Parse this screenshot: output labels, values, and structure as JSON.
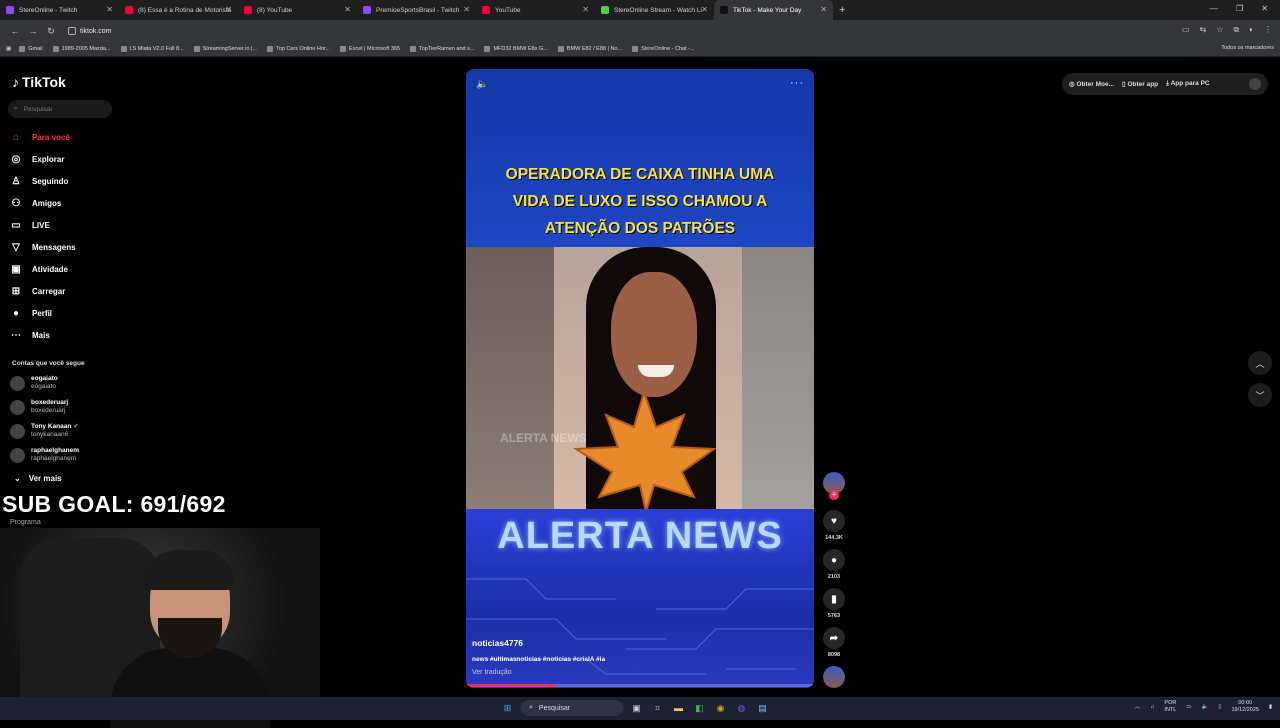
{
  "browser": {
    "tabs": [
      {
        "label": "StereOnline - Twitch",
        "color": "#9146ff"
      },
      {
        "label": "(8) Essa é a Rotina de Motorista",
        "color": "#ff0033"
      },
      {
        "label": "(8) YouTube",
        "color": "#ff0033"
      },
      {
        "label": "PremioeSportsBrasil - Twitch",
        "color": "#9146ff"
      },
      {
        "label": "YouTube",
        "color": "#ff0033"
      },
      {
        "label": "StereOnline Stream - Watch Li",
        "color": "#4bd23a"
      },
      {
        "label": "TikTok - Make Your Day",
        "color": "#111111",
        "active": true
      }
    ],
    "url": "tiktok.com",
    "bookmarks": [
      "Gmail",
      "1989-2005 Mazda...",
      "LS Miata V2.0 Full 8...",
      "StreamingServer.io |...",
      "Top Cars Online Hor...",
      "Excel | Microsoft 365",
      "TopTierRamen and s...",
      "MFD32 BMW E8x G...",
      "BMW E82 / E88 | No...",
      "StereOnline - Chat -..."
    ],
    "bookmarks_right": "Todos os marcadores"
  },
  "sidebar": {
    "logo": "TikTok",
    "search_placeholder": "Pesquisar",
    "nav": [
      {
        "label": "Para você",
        "icon": "home-icon",
        "glyph": "⌂",
        "active": true
      },
      {
        "label": "Explorar",
        "icon": "compass-icon",
        "glyph": "◎"
      },
      {
        "label": "Seguindo",
        "icon": "following-icon",
        "glyph": "♙"
      },
      {
        "label": "Amigos",
        "icon": "friends-icon",
        "glyph": "⚇"
      },
      {
        "label": "LIVE",
        "icon": "live-icon",
        "glyph": "▭"
      },
      {
        "label": "Mensagens",
        "icon": "messages-icon",
        "glyph": "▽"
      },
      {
        "label": "Atividade",
        "icon": "activity-icon",
        "glyph": "▣"
      },
      {
        "label": "Carregar",
        "icon": "upload-icon",
        "glyph": "⊞"
      },
      {
        "label": "Perfil",
        "icon": "profile-icon",
        "glyph": "●"
      },
      {
        "label": "Mais",
        "icon": "more-icon",
        "glyph": "⋯"
      }
    ],
    "following_header": "Contas que você segue",
    "accounts": [
      {
        "name": "eogaiato",
        "handle": "eogaiato"
      },
      {
        "name": "boxederuarj",
        "handle": "boxederuarj"
      },
      {
        "name": "Tony Kanaan",
        "handle": "tonykanaan6",
        "verified": true
      },
      {
        "name": "raphaelghanem",
        "handle": "raphaelghanem"
      }
    ],
    "see_more": "Ver mais"
  },
  "overlay": {
    "sub_goal": "SUB GOAL: 691/692",
    "programa": "Programa"
  },
  "video": {
    "caption_lines": [
      "OPERADORA DE CAIXA TINHA UMA",
      "VIDA DE LUXO E ISSO CHAMOU A",
      "ATENÇÃO DOS PATRÕES"
    ],
    "watermark": "ALERTA NEWS",
    "banner": "ALERTA NEWS",
    "author": "noticias4776",
    "hashtags": "news #ultimasnoticias #noticias #criaIA #ia",
    "translate": "Ver tradução",
    "progress": 0.26
  },
  "actions": {
    "likes": "144.3K",
    "comments": "2103",
    "saves": "5763",
    "shares": "8098"
  },
  "header_right": {
    "coins": "Obter Moe...",
    "get_app": "Obter app",
    "pc_app": "App para PC"
  },
  "taskbar": {
    "search": "Pesquisar",
    "lang": "POR",
    "layout": "INTL",
    "time": "00:00",
    "date": "19/12/2025"
  }
}
